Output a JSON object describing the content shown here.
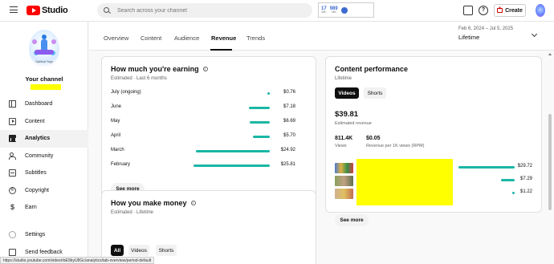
{
  "app": {
    "name": "Studio"
  },
  "search": {
    "placeholder": "Search across your channel"
  },
  "header_stats": {
    "stat1_value": "17",
    "stat1_label": "48h",
    "stat2_value": "989",
    "stat2_label": "48h"
  },
  "header": {
    "help_glyph": "?",
    "create_label": "Create"
  },
  "sidebar": {
    "channel_art_caption": "Spiritual Yoga",
    "channel_label": "Your channel",
    "items": [
      {
        "label": "Dashboard",
        "icon": "dashboard-icon"
      },
      {
        "label": "Content",
        "icon": "content-icon"
      },
      {
        "label": "Analytics",
        "icon": "analytics-icon"
      },
      {
        "label": "Community",
        "icon": "community-icon"
      },
      {
        "label": "Subtitles",
        "icon": "subtitles-icon"
      },
      {
        "label": "Copyright",
        "icon": "copyright-icon"
      },
      {
        "label": "Earn",
        "icon": "earn-icon"
      }
    ],
    "bottom_items": [
      {
        "label": "Settings",
        "icon": "gear-icon"
      },
      {
        "label": "Send feedback",
        "icon": "feedback-icon"
      }
    ],
    "copyright_glyph": "©",
    "earn_glyph": "$"
  },
  "tabs": [
    "Overview",
    "Content",
    "Audience",
    "Revenue",
    "Trends"
  ],
  "date_filter": {
    "range": "Feb 6, 2024 – Jul 5, 2025",
    "value": "Lifetime"
  },
  "earnings_card": {
    "title": "How much you're earning",
    "subtitle": "Estimated · Last 6 months",
    "info_glyph": "i",
    "rows": [
      {
        "label": "July (ongoing)",
        "value": "$0.76",
        "amount": 0.76
      },
      {
        "label": "June",
        "value": "$7.18",
        "amount": 7.18
      },
      {
        "label": "May",
        "value": "$6.69",
        "amount": 6.69
      },
      {
        "label": "April",
        "value": "$5.70",
        "amount": 5.7
      },
      {
        "label": "March",
        "value": "$24.92",
        "amount": 24.92
      },
      {
        "label": "February",
        "value": "$25.81",
        "amount": 25.81
      }
    ],
    "see_more": "See more"
  },
  "money_card": {
    "title": "How you make money",
    "subtitle": "Estimated · Lifetime",
    "chips": [
      "All",
      "Videos",
      "Shorts"
    ]
  },
  "performance_card": {
    "title": "Content performance",
    "subtitle": "Lifetime",
    "chips": [
      "Videos",
      "Shorts"
    ],
    "revenue_value": "$39.81",
    "revenue_label": "Estimated revenue",
    "views_value": "811.4K",
    "views_label": "Views",
    "rpm_value": "$0.05",
    "rpm_label": "Revenue per 1K views (RPM)",
    "videos": [
      {
        "value": "$29.72",
        "amount": 29.72
      },
      {
        "value": "$7.29",
        "amount": 7.29
      },
      {
        "value": "$1.22",
        "amount": 1.22
      }
    ],
    "see_more": "See more"
  },
  "status_bar": {
    "url": "https://studio.youtube.com/video/rbE9byU8Gc/analytics/tab-overview/period-default"
  },
  "colors": {
    "accent": "#1ab6a5",
    "brand": "#ff0000",
    "redaction": "#ffff00"
  }
}
